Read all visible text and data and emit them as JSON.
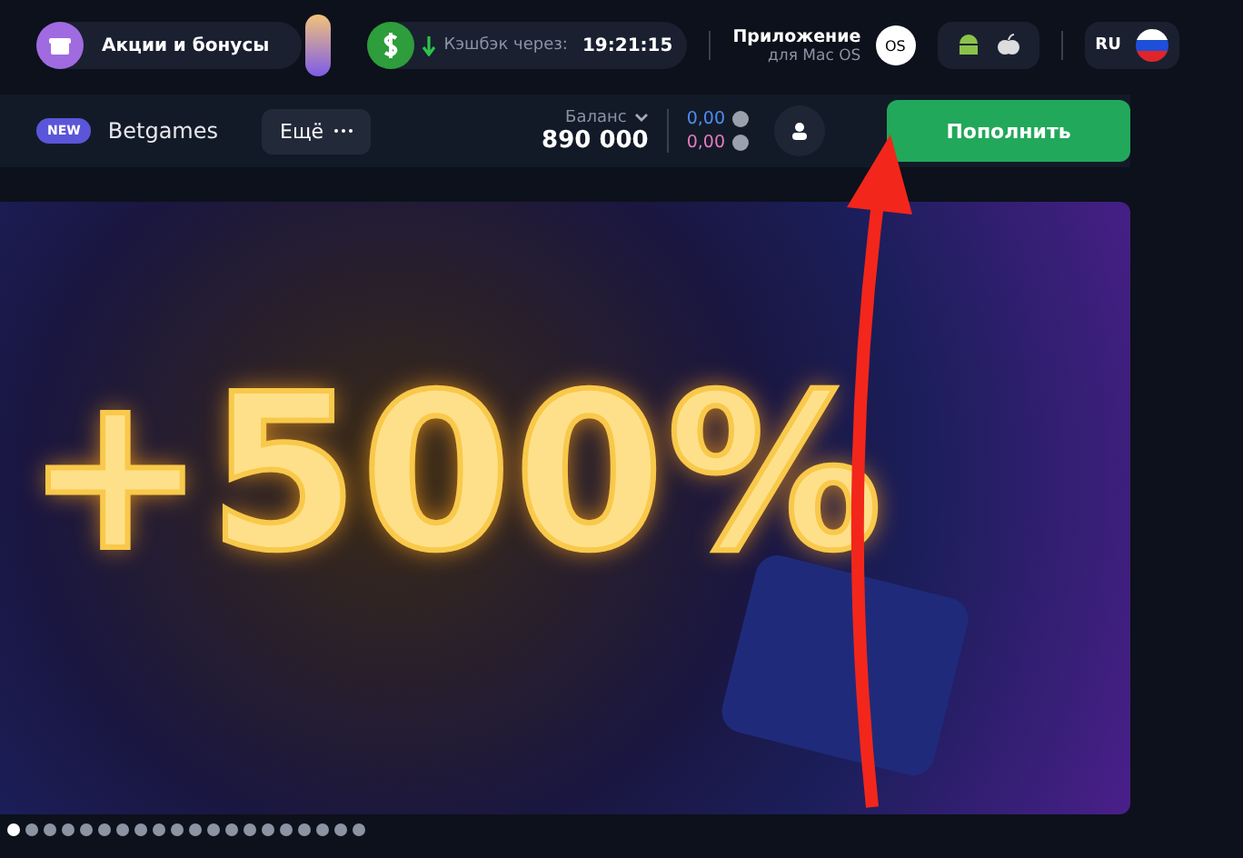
{
  "top_bar": {
    "promo": {
      "label": "Акции и бонусы"
    },
    "cashback": {
      "label": "Кэшбэк через:",
      "time": "19:21:15"
    },
    "app": {
      "title": "Приложение",
      "subtitle": "для Mac OS",
      "os_badge": "OS"
    },
    "language": {
      "code": "RU"
    }
  },
  "nav_bar": {
    "new_badge": "NEW",
    "link": "Betgames",
    "more_button": "Ещё",
    "balance": {
      "label": "Баланс",
      "amount": "890 000"
    },
    "bonus_balances": [
      "0,00",
      "0,00"
    ],
    "deposit_button": "Пополнить"
  },
  "banner": {
    "headline": "+500%"
  },
  "slider_dots": [
    {
      "selected": true
    },
    {
      "selected": false
    },
    {
      "selected": false
    },
    {
      "selected": false
    },
    {
      "selected": false
    },
    {
      "selected": false
    },
    {
      "selected": false
    },
    {
      "selected": false
    },
    {
      "selected": false
    },
    {
      "selected": false
    },
    {
      "selected": false
    },
    {
      "selected": false
    },
    {
      "selected": false
    },
    {
      "selected": false
    },
    {
      "selected": false
    },
    {
      "selected": false
    },
    {
      "selected": false
    },
    {
      "selected": false
    },
    {
      "selected": false
    },
    {
      "selected": false
    }
  ]
}
